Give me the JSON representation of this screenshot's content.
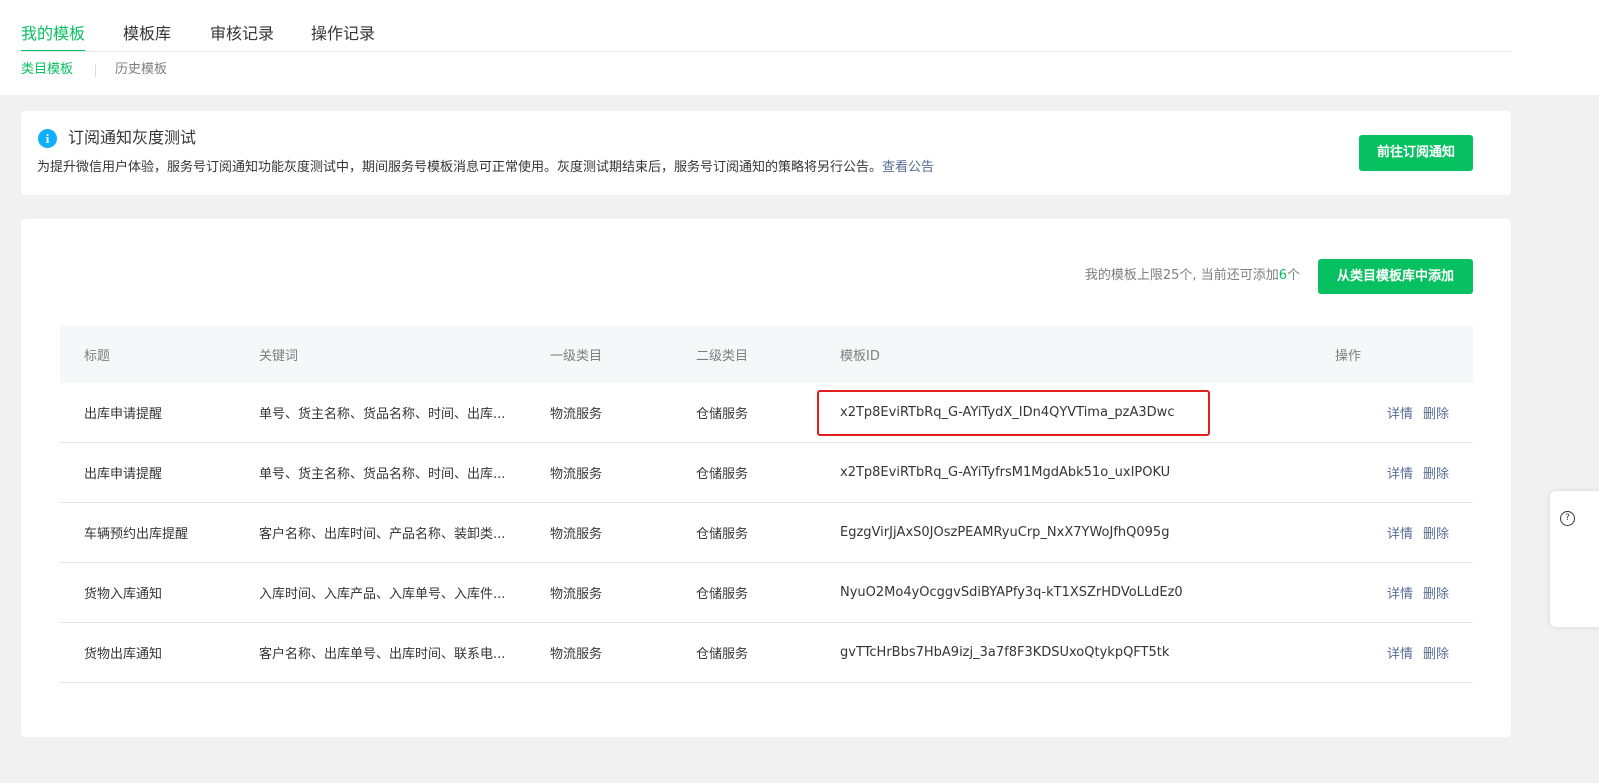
{
  "tabs": [
    {
      "label": "我的模板",
      "active": true
    },
    {
      "label": "模板库",
      "active": false
    },
    {
      "label": "审核记录",
      "active": false
    },
    {
      "label": "操作记录",
      "active": false
    }
  ],
  "subtabs": [
    {
      "label": "类目模板",
      "active": true
    },
    {
      "label": "历史模板",
      "active": false
    }
  ],
  "notice": {
    "icon": "info-icon",
    "title": "订阅通知灰度测试",
    "description": "为提升微信用户体验，服务号订阅通知功能灰度测试中，期间服务号模板消息可正常使用。灰度测试期结束后，服务号订阅通知的策略将另行公告。",
    "link_label": "查看公告",
    "button_label": "前往订阅通知"
  },
  "quota": {
    "prefix": "我的模板上限25个, 当前还可添加",
    "remaining": "6",
    "suffix": "个"
  },
  "add_button_label": "从类目模板库中添加",
  "table": {
    "headers": {
      "title": "标题",
      "keywords": "关键词",
      "category1": "一级类目",
      "category2": "二级类目",
      "template_id": "模板ID",
      "actions": "操作"
    },
    "rows": [
      {
        "title": "出库申请提醒",
        "keywords": "单号、货主名称、货品名称、时间、出库...",
        "category1": "物流服务",
        "category2": "仓储服务",
        "template_id": "x2Tp8EviRTbRq_G-AYiTydX_IDn4QYVTima_pzA3Dwc",
        "detail": "详情",
        "delete": "删除"
      },
      {
        "title": "出库申请提醒",
        "keywords": "单号、货主名称、货品名称、时间、出库...",
        "category1": "物流服务",
        "category2": "仓储服务",
        "template_id": "x2Tp8EviRTbRq_G-AYiTyfrsM1MgdAbk51o_uxIPOKU",
        "detail": "详情",
        "delete": "删除"
      },
      {
        "title": "车辆预约出库提醒",
        "keywords": "客户名称、出库时间、产品名称、装卸类...",
        "category1": "物流服务",
        "category2": "仓储服务",
        "template_id": "EgzgVirJjAxS0JOszPEAMRyuCrp_NxX7YWoJfhQ095g",
        "detail": "详情",
        "delete": "删除"
      },
      {
        "title": "货物入库通知",
        "keywords": "入库时间、入库产品、入库单号、入库件...",
        "category1": "物流服务",
        "category2": "仓储服务",
        "template_id": "NyuO2Mo4yOcggvSdiBYAPfy3q-kT1XSZrHDVoLLdEz0",
        "detail": "详情",
        "delete": "删除"
      },
      {
        "title": "货物出库通知",
        "keywords": "客户名称、出库单号、出库时间、联系电...",
        "category1": "物流服务",
        "category2": "仓储服务",
        "template_id": "gvTTcHrBbs7HbA9izj_3a7f8F3KDSUxoQtykpQFT5tk",
        "detail": "详情",
        "delete": "删除"
      }
    ]
  },
  "colors": {
    "accent": "#07c160",
    "link": "#576b95",
    "info": "#10aeff",
    "highlight_border": "#e02020"
  }
}
